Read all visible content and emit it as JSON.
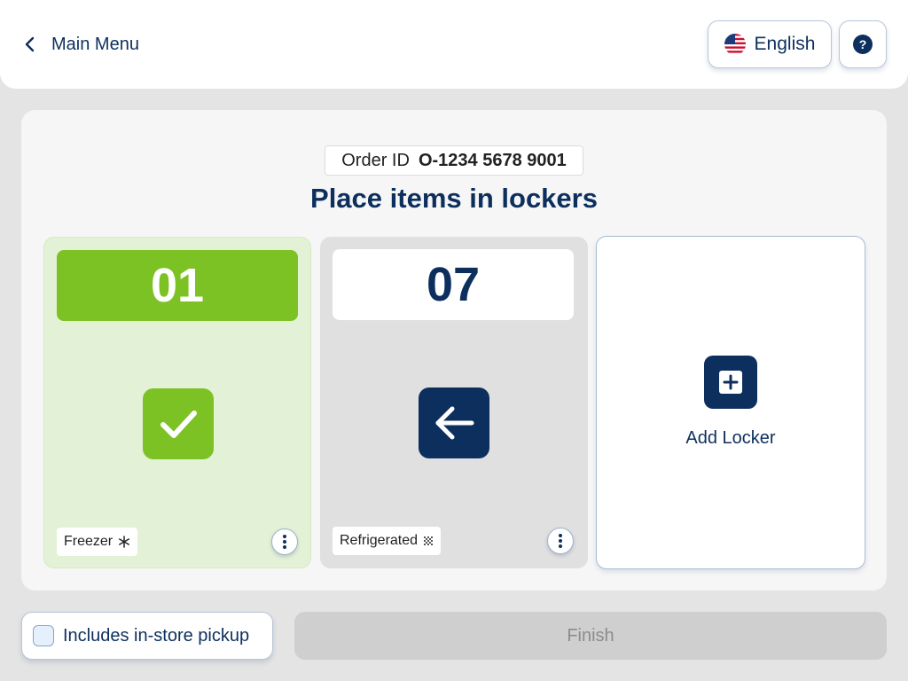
{
  "header": {
    "back_label": "Main Menu",
    "language_label": "English",
    "help_symbol": "?"
  },
  "order": {
    "id_label": "Order ID",
    "id_value": "O-1234 5678 9001"
  },
  "title": "Place items in lockers",
  "lockers": [
    {
      "number": "01",
      "status": "done",
      "status_icon": "check-icon",
      "temperature": "Freezer",
      "temp_icon": "snowflake-icon",
      "color": "#7cc225"
    },
    {
      "number": "07",
      "status": "pending",
      "status_icon": "arrow-left-icon",
      "temperature": "Refrigerated",
      "temp_icon": "cold-icon",
      "color": "#0d2f5e"
    }
  ],
  "add_locker": {
    "label": "Add Locker",
    "icon": "plus-icon"
  },
  "footer": {
    "pickup_label": "Includes in-store pickup",
    "pickup_checked": false,
    "finish_label": "Finish",
    "finish_enabled": false
  },
  "colors": {
    "primary": "#0d2f5e",
    "success": "#7cc225",
    "success_bg": "#e3f1d6",
    "disabled": "#cfcfcf"
  }
}
